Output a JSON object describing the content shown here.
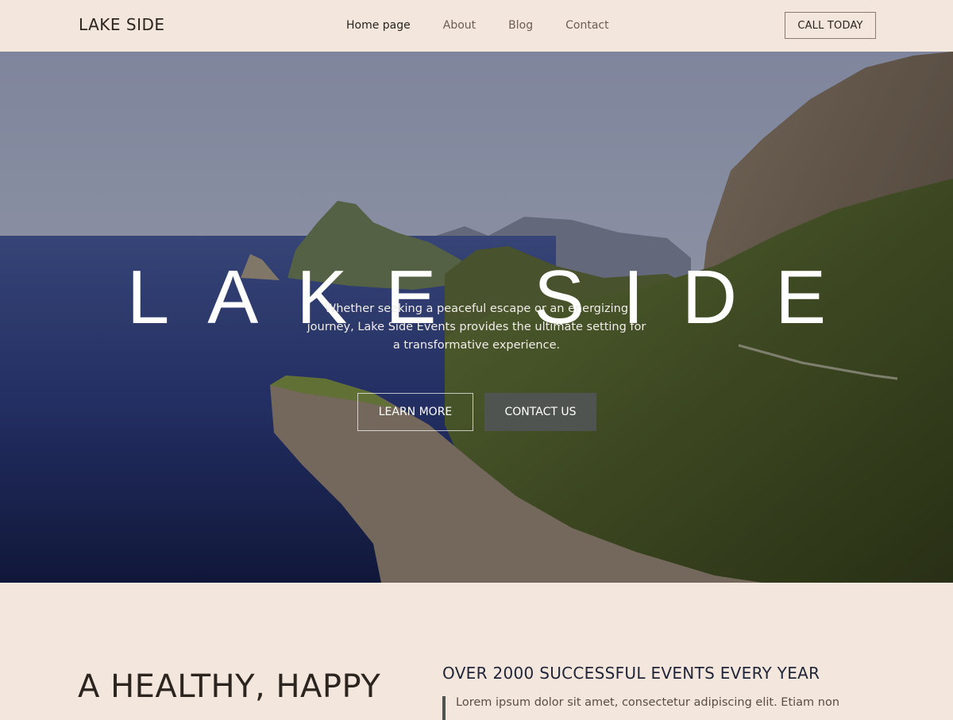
{
  "header": {
    "logo": "LAKE SIDE",
    "nav": [
      {
        "label": "Home page",
        "active": true
      },
      {
        "label": "About",
        "active": false
      },
      {
        "label": "Blog",
        "active": false
      },
      {
        "label": "Contact",
        "active": false
      }
    ],
    "cta": "CALL TODAY"
  },
  "hero": {
    "title": "LAKE SIDE",
    "subtitle": "Whether seeking a peaceful escape or an energizing journey, Lake Side Events provides the ultimate setting for a transformative experience.",
    "primary_button": "LEARN MORE",
    "secondary_button": "CONTACT US",
    "image_alt": "coastal-cliffs-photo"
  },
  "section": {
    "heading": "A HEALTHY, HAPPY",
    "stat_heading": "OVER 2000 SUCCESSFUL EVENTS EVERY YEAR",
    "quote": "Lorem ipsum dolor sit amet, consectetur adipiscing elit. Etiam non"
  },
  "colors": {
    "background": "#f3e6dc",
    "text_dark": "#2b241f",
    "button_dark": "#4f5450",
    "heading_navy": "#1f2438"
  }
}
